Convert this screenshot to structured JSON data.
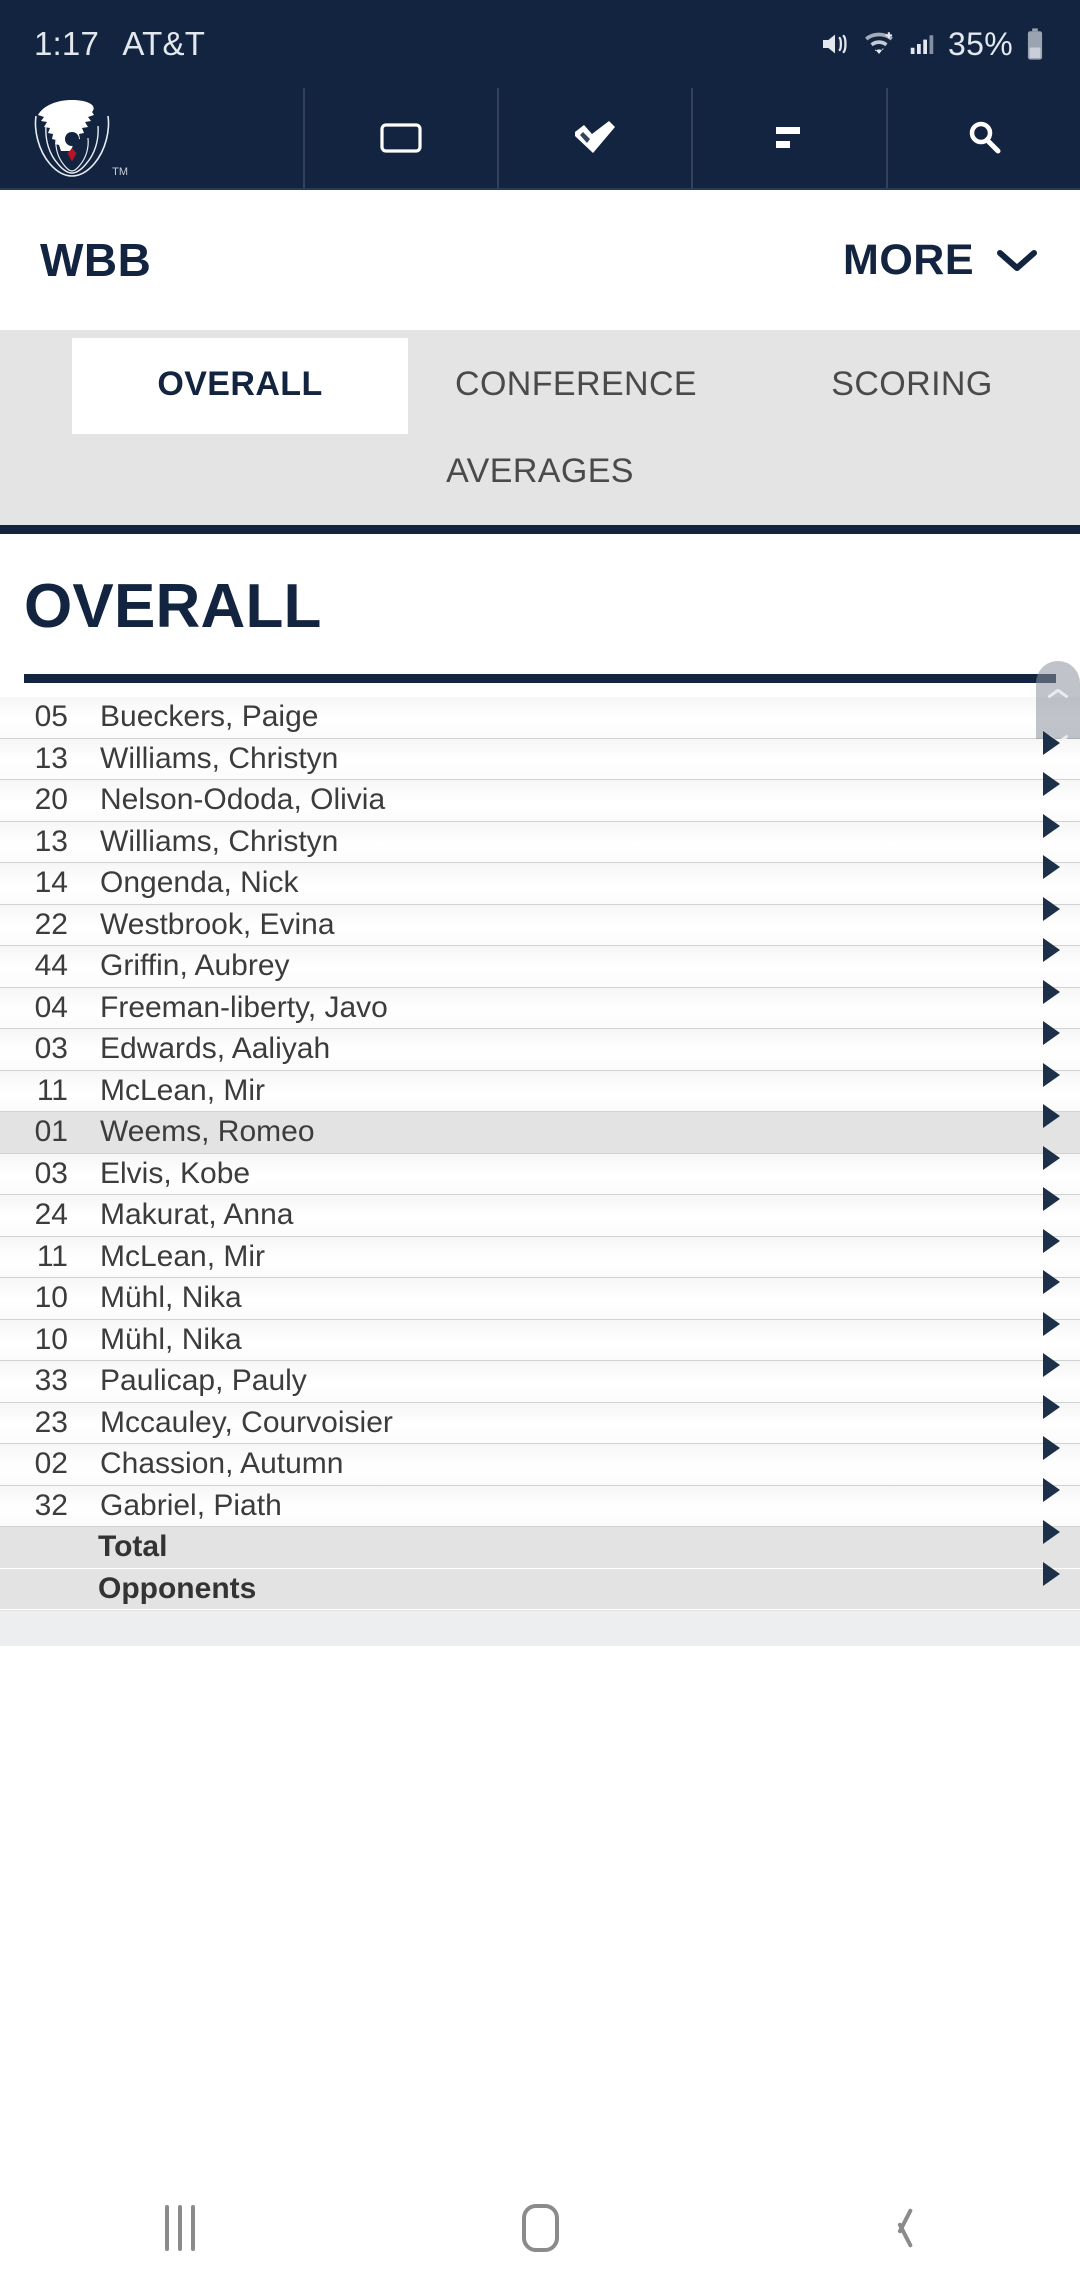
{
  "status_bar": {
    "time": "1:17",
    "carrier": "AT&T",
    "battery_percent": "35%",
    "icons": [
      "mute-icon",
      "wifi-icon",
      "cell-signal-icon",
      "battery-icon"
    ]
  },
  "app_nav": {
    "logo_name": "uconn-husky-logo",
    "trademark": "TM",
    "items": [
      {
        "icon": "card-outline-icon",
        "label": ""
      },
      {
        "icon": "ticket-check-icon",
        "label": ""
      },
      {
        "icon": "list-lines-icon",
        "label": ""
      },
      {
        "icon": "search-icon",
        "label": ""
      }
    ]
  },
  "header": {
    "title": "WBB",
    "more_label": "MORE",
    "more_icon": "chevron-down-icon"
  },
  "tabs": {
    "row1": [
      {
        "label": "OVERALL",
        "active": true
      },
      {
        "label": "CONFERENCE",
        "active": false
      },
      {
        "label": "SCORING",
        "active": false
      }
    ],
    "row2": [
      {
        "label": "AVERAGES",
        "active": false
      }
    ]
  },
  "section": {
    "title": "OVERALL"
  },
  "table": {
    "rows": [
      {
        "number": "05",
        "name": "Bueckers, Paige",
        "style": "normal"
      },
      {
        "number": "13",
        "name": "Williams, Christyn",
        "style": "normal"
      },
      {
        "number": "20",
        "name": "Nelson-Ododa, Olivia",
        "style": "normal"
      },
      {
        "number": "13",
        "name": "Williams, Christyn",
        "style": "normal"
      },
      {
        "number": "14",
        "name": "Ongenda, Nick",
        "style": "normal"
      },
      {
        "number": "22",
        "name": "Westbrook, Evina",
        "style": "normal"
      },
      {
        "number": "44",
        "name": "Griffin, Aubrey",
        "style": "normal"
      },
      {
        "number": "04",
        "name": "Freeman-liberty, Javo",
        "style": "normal"
      },
      {
        "number": "03",
        "name": "Edwards, Aaliyah",
        "style": "normal"
      },
      {
        "number": "11",
        "name": "McLean, Mir",
        "style": "normal"
      },
      {
        "number": "01",
        "name": "Weems, Romeo",
        "style": "alt"
      },
      {
        "number": "03",
        "name": "Elvis, Kobe",
        "style": "normal"
      },
      {
        "number": "24",
        "name": "Makurat, Anna",
        "style": "normal"
      },
      {
        "number": "11",
        "name": "McLean, Mir",
        "style": "normal"
      },
      {
        "number": "10",
        "name": "Mühl, Nika",
        "style": "normal"
      },
      {
        "number": "10",
        "name": "Mühl, Nika",
        "style": "normal"
      },
      {
        "number": "33",
        "name": "Paulicap, Pauly",
        "style": "normal"
      },
      {
        "number": "23",
        "name": "Mccauley, Courvoisier",
        "style": "normal"
      },
      {
        "number": "02",
        "name": "Chassion, Autumn",
        "style": "normal"
      },
      {
        "number": "32",
        "name": "Gabriel, Piath",
        "style": "normal"
      },
      {
        "number": "",
        "name": "Total",
        "style": "summary"
      },
      {
        "number": "",
        "name": "Opponents",
        "style": "summary"
      }
    ]
  },
  "scroll_control": {
    "up_icon": "chevron-up-icon",
    "down_icon": "chevron-down-icon"
  },
  "android_nav": {
    "recents_icon": "recents-icon",
    "home_icon": "home-icon",
    "back_icon": "back-icon"
  },
  "colors": {
    "navy": "#12243F",
    "tab_bg": "#E4E4E4",
    "row_alt": "#E3E3E3"
  }
}
